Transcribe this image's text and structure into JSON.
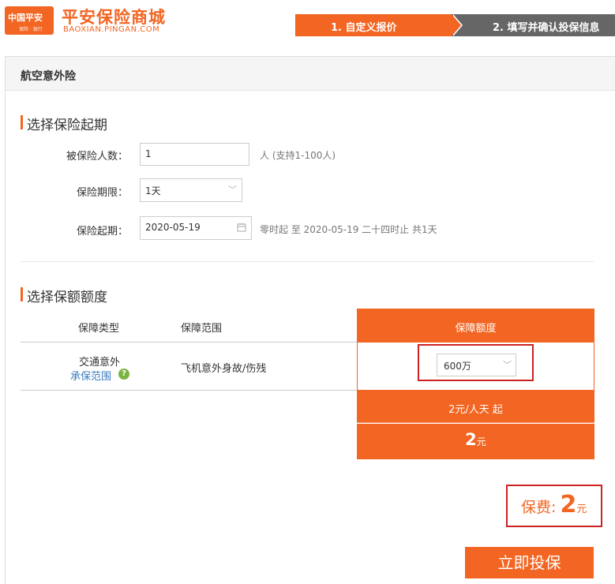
{
  "header": {
    "logo_line1": "中国平安",
    "logo_line2": "保险 · 银行",
    "brand_cn": "平安保险商城",
    "brand_en": "BAOXIAN.PINGAN.COM",
    "steps": [
      {
        "label": "1. 自定义报价",
        "active": true
      },
      {
        "label": "2. 填写并确认投保信息",
        "active": false
      }
    ]
  },
  "panel": {
    "title": "航空意外险"
  },
  "section_start": {
    "title": "选择保险起期",
    "insured_count": {
      "label": "被保险人数：",
      "value": "1",
      "hint": "人 (支持1-100人)"
    },
    "period": {
      "label": "保险期限：",
      "value": "1天"
    },
    "start_date": {
      "label": "保险起期：",
      "value": "2020-05-19",
      "hint": "零时起 至 2020-05-19 二十四时止 共1天"
    }
  },
  "section_coverage": {
    "title": "选择保额额度",
    "headers": {
      "type": "保障类型",
      "scope": "保障范围",
      "amount": "保障额度"
    },
    "row": {
      "type": "交通意外",
      "scope_link": "承保范围",
      "scope_desc": "飞机意外身故/伤残",
      "amount_value": "600万"
    },
    "rate": "2元/人天 起",
    "price_num": "2",
    "price_unit": "元"
  },
  "total": {
    "label": "保费:",
    "value": "2",
    "unit": "元"
  },
  "actions": {
    "submit": "立即投保"
  },
  "colors": {
    "accent": "#f26522",
    "highlight_border": "#cc2222",
    "link": "#3a7bbf",
    "help_icon": "#7cb342"
  }
}
